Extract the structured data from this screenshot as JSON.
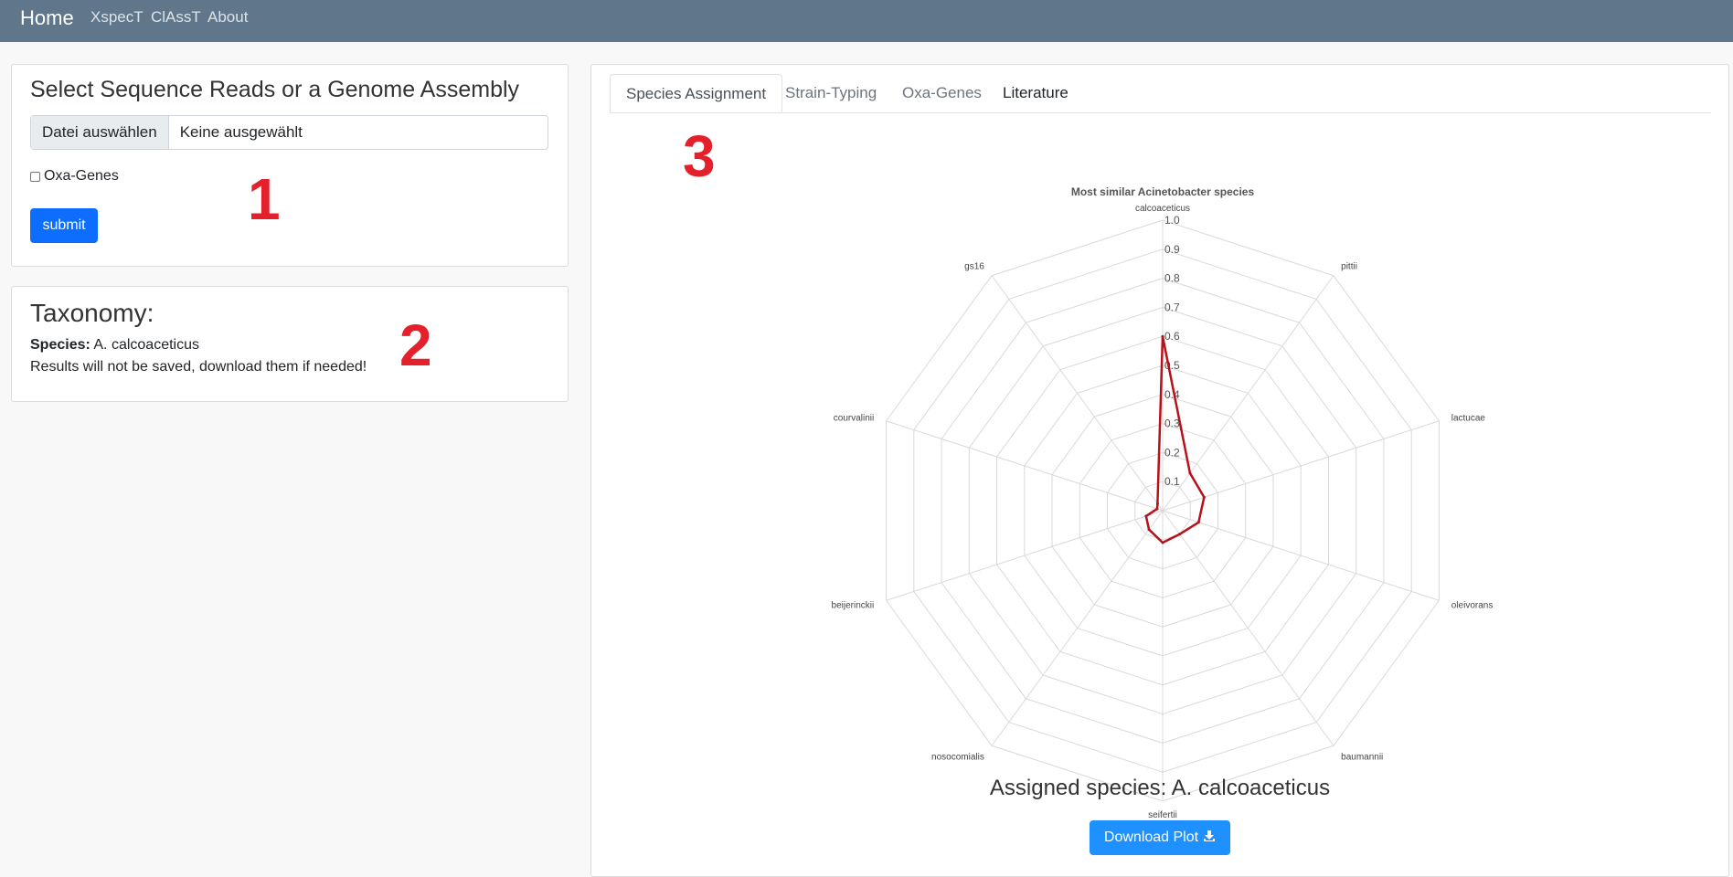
{
  "nav": {
    "brand": "Home",
    "links": [
      "XspecT",
      "ClAssT",
      "About"
    ]
  },
  "upload": {
    "title": "Select Sequence Reads or a Genome Assembly",
    "file_button": "Datei auswählen",
    "file_name": "Keine ausgewählt",
    "checkbox_label": "Oxa-Genes",
    "submit": "submit"
  },
  "taxonomy": {
    "title": "Taxonomy:",
    "species_label": "Species:",
    "species_value": "A. calcoaceticus",
    "note": "Results will not be saved, download them if needed!"
  },
  "annotations": [
    "1",
    "2",
    "3"
  ],
  "tabs": [
    "Species Assignment",
    "Strain-Typing",
    "Oxa-Genes",
    "Literature"
  ],
  "chart_data": {
    "type": "radar",
    "title": "Most similar Acinetobacter species",
    "categories": [
      "calcoaceticus",
      "pittii",
      "lactucae",
      "oleivorans",
      "baumannii",
      "seifertii",
      "nosocomialis",
      "beijerinckii",
      "courvalinii",
      "gs16"
    ],
    "values": [
      0.6,
      0.16,
      0.15,
      0.13,
      0.1,
      0.11,
      0.08,
      0.06,
      0.02,
      0.03
    ],
    "range": [
      0,
      1
    ],
    "ticks": [
      "0.1",
      "0.2",
      "0.3",
      "0.4",
      "0.5",
      "0.6",
      "0.7",
      "0.8",
      "0.9",
      "1.0"
    ],
    "line_color": "#b5121b",
    "grid": true
  },
  "result": {
    "assigned": "Assigned species: A. calcoaceticus",
    "download": "Download Plot"
  }
}
